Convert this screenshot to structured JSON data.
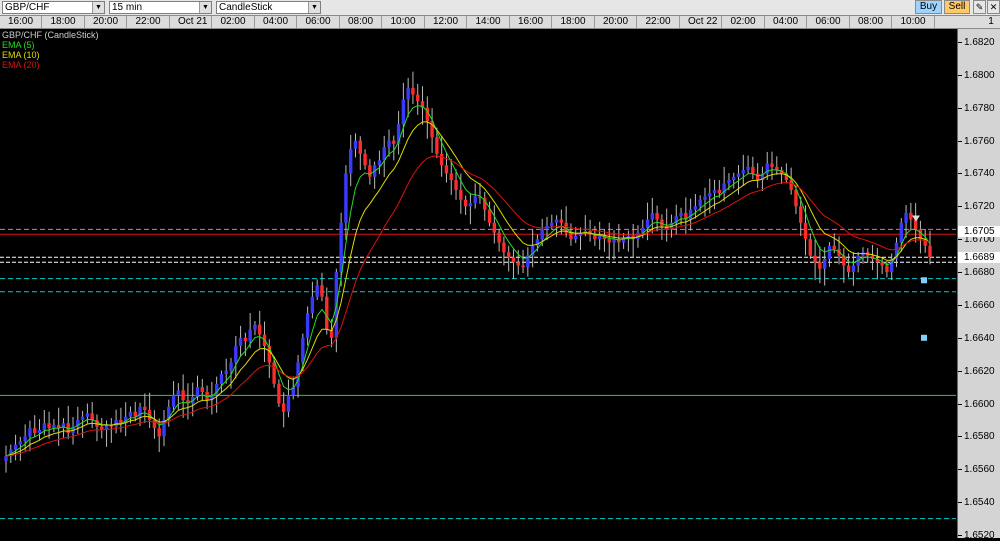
{
  "toolbar": {
    "symbol": "GBP/CHF",
    "interval": "15 min",
    "chart_type": "CandleStick",
    "buy_label": "Buy",
    "sell_label": "Sell",
    "page_label": "1"
  },
  "time_axis": {
    "labels": [
      "16:00",
      "18:00",
      "20:00",
      "22:00",
      "Oct 21",
      "02:00",
      "04:00",
      "06:00",
      "08:00",
      "10:00",
      "12:00",
      "14:00",
      "16:00",
      "18:00",
      "20:00",
      "22:00",
      "Oct 22",
      "02:00",
      "04:00",
      "06:00",
      "08:00",
      "10:00"
    ]
  },
  "legend": {
    "title": "GBP/CHF (CandleStick)",
    "items": [
      {
        "label": "EMA (5)",
        "color": "#22dd22"
      },
      {
        "label": "EMA (10)",
        "color": "#dddd00"
      },
      {
        "label": "EMA (20)",
        "color": "#dd1111"
      }
    ]
  },
  "price_axis": {
    "labels": [
      "1.6820",
      "1.6800",
      "1.6780",
      "1.6760",
      "1.6740",
      "1.6720",
      "1.6700",
      "1.6680",
      "1.6660",
      "1.6640",
      "1.6620",
      "1.6600",
      "1.6580",
      "1.6560",
      "1.6540",
      "1.6520"
    ],
    "highlight": [
      {
        "label": "1.6705",
        "bg": "#ffffff"
      },
      {
        "label": "1.6689",
        "bg": "#ffffff"
      }
    ]
  },
  "colors": {
    "bull": "#3a3aff",
    "bear": "#ff2a2a",
    "wick": "#bbbbbb",
    "ema5": "#22dd22",
    "ema10": "#dddd00",
    "ema20": "#dd1111",
    "dashed_cyan": "#00cccc",
    "green_line": "#2ecc40",
    "pink_line": "#ff66aa",
    "marker": "#7fd0ff"
  },
  "levels": {
    "cyan_dashed": [
      1.6676,
      1.6668,
      1.653
    ],
    "white_dashed": [
      1.6689,
      1.6686
    ],
    "pink_dashed": 1.6706,
    "red_solid": 1.6703,
    "green_solid": 1.6605,
    "markers": [
      1.6675,
      1.664
    ]
  },
  "chart_data": {
    "type": "candlestick",
    "symbol": "GBP/CHF",
    "interval": "15 min",
    "ylim": [
      1.652,
      1.682
    ],
    "grid": false,
    "closes": [
      1.6568,
      1.6572,
      1.6575,
      1.6577,
      1.658,
      1.6585,
      1.6582,
      1.6584,
      1.6588,
      1.6585,
      1.6587,
      1.6585,
      1.6588,
      1.6582,
      1.6586,
      1.659,
      1.6592,
      1.6594,
      1.659,
      1.6586,
      1.6584,
      1.6587,
      1.6586,
      1.659,
      1.6588,
      1.6592,
      1.6595,
      1.6592,
      1.6598,
      1.6596,
      1.659,
      1.6585,
      1.658,
      1.659,
      1.6598,
      1.6605,
      1.6608,
      1.6602,
      1.66,
      1.6604,
      1.661,
      1.6607,
      1.6602,
      1.6605,
      1.6612,
      1.6618,
      1.662,
      1.6625,
      1.6635,
      1.664,
      1.6638,
      1.6645,
      1.6648,
      1.6642,
      1.6635,
      1.6625,
      1.6612,
      1.66,
      1.6595,
      1.6605,
      1.661,
      1.6625,
      1.664,
      1.6655,
      1.6665,
      1.6672,
      1.6665,
      1.6645,
      1.664,
      1.668,
      1.671,
      1.674,
      1.6755,
      1.676,
      1.6752,
      1.6745,
      1.6738,
      1.6745,
      1.6748,
      1.6756,
      1.676,
      1.6758,
      1.677,
      1.6785,
      1.6792,
      1.6788,
      1.6784,
      1.678,
      1.6772,
      1.6762,
      1.6752,
      1.6745,
      1.674,
      1.6736,
      1.673,
      1.6724,
      1.672,
      1.6722,
      1.6726,
      1.6725,
      1.6718,
      1.671,
      1.6704,
      1.6698,
      1.6692,
      1.6689,
      1.6686,
      1.6684,
      1.6683,
      1.669,
      1.6696,
      1.67,
      1.6706,
      1.6708,
      1.671,
      1.6712,
      1.671,
      1.6704,
      1.67,
      1.6702,
      1.6704,
      1.6705,
      1.6703,
      1.67,
      1.6702,
      1.67,
      1.6698,
      1.67,
      1.6698,
      1.6701,
      1.6702,
      1.67,
      1.6704,
      1.6707,
      1.6712,
      1.6716,
      1.6712,
      1.6708,
      1.6706,
      1.671,
      1.6714,
      1.6716,
      1.6712,
      1.6718,
      1.672,
      1.6724,
      1.6726,
      1.6728,
      1.673,
      1.6728,
      1.6734,
      1.6736,
      1.6738,
      1.674,
      1.6742,
      1.6744,
      1.674,
      1.6736,
      1.674,
      1.6746,
      1.6744,
      1.6742,
      1.674,
      1.6736,
      1.673,
      1.672,
      1.671,
      1.67,
      1.669,
      1.6686,
      1.6682,
      1.6688,
      1.6696,
      1.6694,
      1.669,
      1.6684,
      1.668,
      1.6684,
      1.669,
      1.6692,
      1.669,
      1.6688,
      1.6686,
      1.6684,
      1.668,
      1.6688,
      1.6698,
      1.671,
      1.6716,
      1.6712,
      1.6706,
      1.67,
      1.6696,
      1.6689
    ]
  }
}
